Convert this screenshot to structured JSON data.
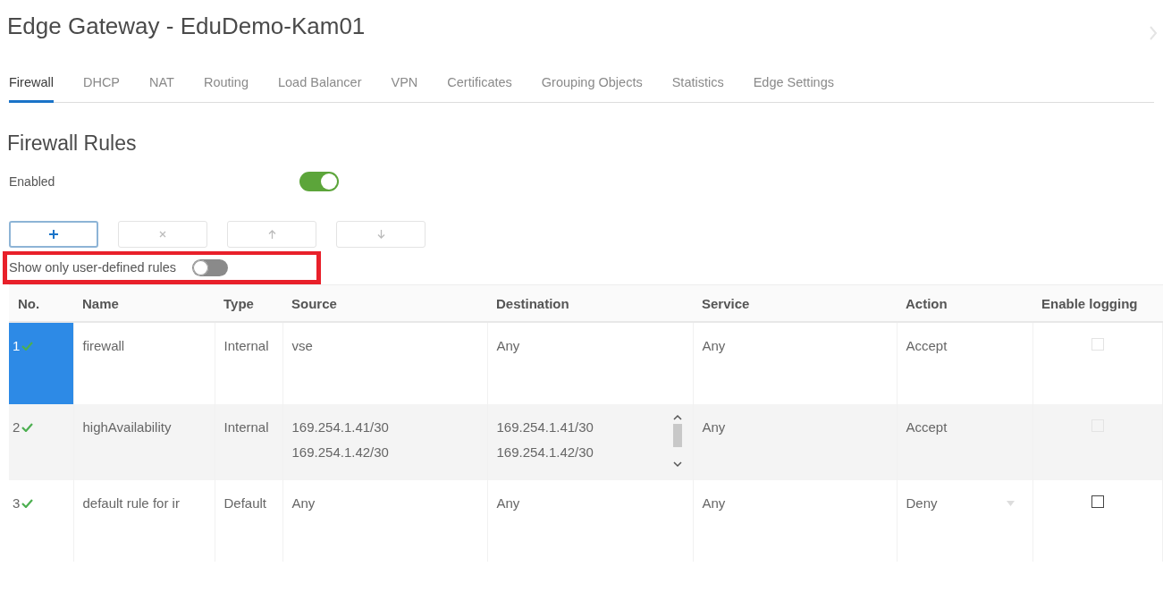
{
  "page": {
    "title": "Edge Gateway - EduDemo-Kam01"
  },
  "tabs": [
    {
      "label": "Firewall",
      "selected": true
    },
    {
      "label": "DHCP",
      "selected": false
    },
    {
      "label": "NAT",
      "selected": false
    },
    {
      "label": "Routing",
      "selected": false
    },
    {
      "label": "Load Balancer",
      "selected": false
    },
    {
      "label": "VPN",
      "selected": false
    },
    {
      "label": "Certificates",
      "selected": false
    },
    {
      "label": "Grouping Objects",
      "selected": false
    },
    {
      "label": "Statistics",
      "selected": false
    },
    {
      "label": "Edge Settings",
      "selected": false
    }
  ],
  "section": {
    "title": "Firewall Rules",
    "enabled_label": "Enabled",
    "enabled_on": true
  },
  "toolbar": [
    {
      "kind": "add",
      "disabled": false
    },
    {
      "kind": "delete",
      "disabled": true
    },
    {
      "kind": "move-up",
      "disabled": true
    },
    {
      "kind": "move-down",
      "disabled": true
    }
  ],
  "filter": {
    "label": "Show only user-defined rules",
    "on": false,
    "highlighted": true
  },
  "table": {
    "columns": [
      "No.",
      "Name",
      "Type",
      "Source",
      "Destination",
      "Service",
      "Action",
      "Enable logging"
    ],
    "rows": [
      {
        "no": "1",
        "enabled": true,
        "selected": true,
        "name": "firewall",
        "type": "Internal",
        "source": [
          "vse"
        ],
        "destination": [
          "Any"
        ],
        "destination_scroll": false,
        "service": "Any",
        "action": "Accept",
        "action_dropdown": false,
        "logging": false,
        "logging_disabled": true
      },
      {
        "no": "2",
        "enabled": true,
        "selected": false,
        "name": "highAvailability",
        "type": "Internal",
        "source": [
          "169.254.1.41/30",
          "169.254.1.42/30"
        ],
        "destination": [
          "169.254.1.41/30",
          "169.254.1.42/30"
        ],
        "destination_scroll": true,
        "service": "Any",
        "action": "Accept",
        "action_dropdown": false,
        "logging": false,
        "logging_disabled": true
      },
      {
        "no": "3",
        "enabled": true,
        "selected": false,
        "name": "default rule for ir",
        "type": "Default",
        "source": [
          "Any"
        ],
        "destination": [
          "Any"
        ],
        "destination_scroll": false,
        "service": "Any",
        "action": "Deny",
        "action_dropdown": true,
        "logging": false,
        "logging_disabled": false
      }
    ]
  }
}
